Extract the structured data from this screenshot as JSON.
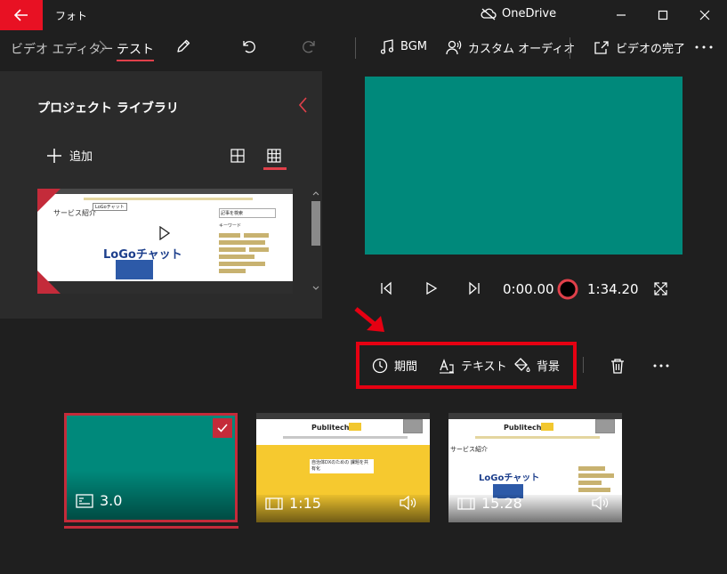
{
  "window": {
    "title": "フォト",
    "cloud_label": "OneDrive"
  },
  "toolbar": {
    "breadcrumb_root": "ビデオ エディター",
    "breadcrumb_current": "テスト",
    "bgm_label": "BGM",
    "custom_audio_label": "カスタム オーディオ",
    "finish_label": "ビデオの完了"
  },
  "library": {
    "title": "プロジェクト ライブラリ",
    "add_label": "追加",
    "thumb": {
      "section_title": "サービス紹介",
      "logo_label": "LoGoチャット",
      "tag": "LoGoチャット",
      "keywords_title": "キーワード",
      "search_placeholder": "記事を検索"
    }
  },
  "player": {
    "current_time": "0:00.00",
    "total_time": "1:34.20"
  },
  "actions": {
    "duration_label": "期間",
    "text_label": "テキスト",
    "background_label": "背景"
  },
  "storyboard": {
    "cards": [
      {
        "label": "3.0",
        "kind": "title-card",
        "color": "#00897b",
        "selected": true
      },
      {
        "label": "1:15",
        "kind": "video",
        "brand": "Publitech",
        "headline": "自治体DXのための 課題を共有化"
      },
      {
        "label": "15.28",
        "kind": "video",
        "brand": "Publitech",
        "headline": "サービス紹介",
        "logo": "LoGoチャット"
      }
    ]
  },
  "colors": {
    "accent_red": "#e81123",
    "highlight_red": "#e60012",
    "teal": "#00897b",
    "selection_red": "#c42b3a"
  }
}
